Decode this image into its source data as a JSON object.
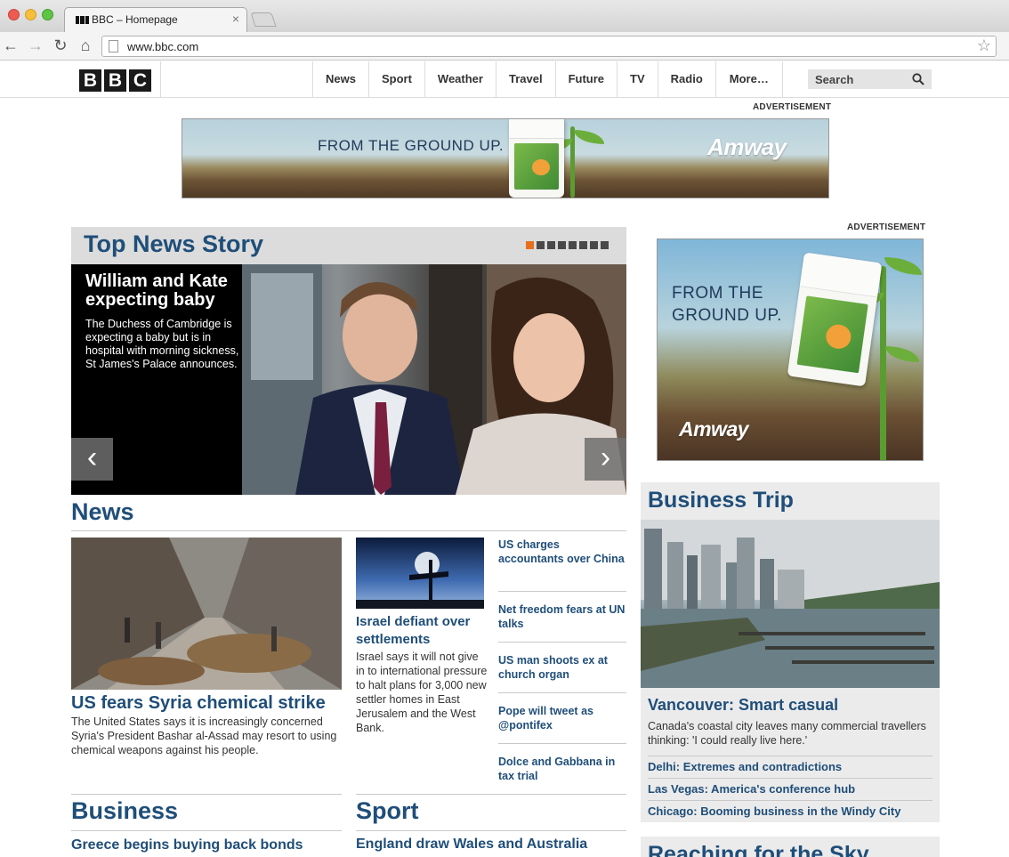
{
  "browser": {
    "tab_title": "BBC – Homepage",
    "tab_close": "×",
    "url": "www.bbc.com",
    "back_icon": "←",
    "forward_icon": "→",
    "reload_icon": "↻",
    "home_icon": "⌂",
    "star_icon": "☆"
  },
  "header": {
    "logo_letters": [
      "B",
      "B",
      "C"
    ],
    "nav": [
      "News",
      "Sport",
      "Weather",
      "Travel",
      "Future",
      "TV",
      "Radio",
      "More…"
    ],
    "search_placeholder": "Search"
  },
  "ads": {
    "label": "ADVERTISEMENT",
    "banner_tagline": "FROM THE GROUND UP.",
    "banner_brand": "Amway",
    "side_tagline_line1": "FROM THE",
    "side_tagline_line2": "GROUND UP.",
    "side_brand": "Amway"
  },
  "top_story": {
    "section_title": "Top News Story",
    "slide_count": 8,
    "active_slide": 1,
    "headline": "William and Kate expecting baby",
    "summary": "The Duchess of Cambridge is expecting a baby but is in hospital with morning sickness, St James's Palace announces.",
    "prev_icon": "‹",
    "next_icon": "›"
  },
  "news": {
    "section_title": "News",
    "lead_headline": "US fears Syria chemical strike",
    "lead_summary": "The United States says it is increasingly concerned Syria's President Bashar al-Assad may resort to using chemical weapons against his people.",
    "second_headline": "Israel defiant over settlements",
    "second_summary": "Israel says it will not give in to international pressure to halt plans for 3,000 new settler homes in East Jerusalem and the West Bank.",
    "links": [
      "US charges accountants over China",
      "Net freedom fears at UN talks",
      "US man shoots ex at church organ",
      "Pope will tweet as @pontifex",
      "Dolce and Gabbana in tax trial"
    ]
  },
  "business": {
    "section_title": "Business",
    "headline": "Greece begins buying back bonds"
  },
  "sport": {
    "section_title": "Sport",
    "headline": "England draw Wales and Australia"
  },
  "business_trip": {
    "title": "Business Trip",
    "headline": "Vancouver: Smart casual",
    "summary": "Canada's coastal city leaves many commercial travellers thinking: 'I could really live here.'",
    "links": [
      "Delhi: Extremes and contradictions",
      "Las Vegas: America's conference hub",
      "Chicago: Booming business in the Windy City"
    ]
  },
  "reaching": {
    "title": "Reaching for the Sky"
  }
}
